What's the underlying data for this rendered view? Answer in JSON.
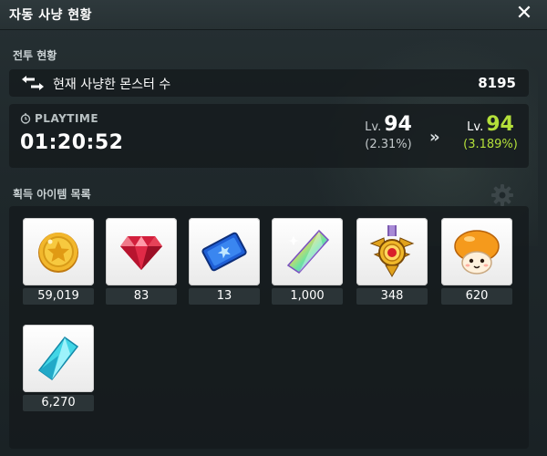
{
  "window": {
    "title": "자동 사냥 현황",
    "close_symbol": "✕"
  },
  "battle": {
    "section_label": "전투 현황",
    "monster_label": "현재 사냥한 몬스터 수",
    "monster_count": "8195",
    "playtime_label": "PLAYTIME",
    "playtime_value": "01:20:52",
    "level_from": {
      "prefix": "Lv.",
      "level": "94",
      "percent": "(2.31%)"
    },
    "level_arrow": "»",
    "level_to": {
      "prefix": "Lv.",
      "level": "94",
      "percent": "(3.189%)"
    }
  },
  "items": {
    "section_label": "획득 아이템 목록",
    "list": [
      {
        "icon": "gold-coin-icon",
        "count": "59,019"
      },
      {
        "icon": "red-gem-icon",
        "count": "83"
      },
      {
        "icon": "blue-ticket-icon",
        "count": "13"
      },
      {
        "icon": "rainbow-crystal-icon",
        "count": "1,000"
      },
      {
        "icon": "medal-icon",
        "count": "348"
      },
      {
        "icon": "orange-mushroom-icon",
        "count": "620"
      },
      {
        "icon": "cyan-crystal-icon",
        "count": "6,270"
      }
    ]
  },
  "colors": {
    "accent_green": "#b4e03a",
    "panel_bg": "#141a1c",
    "window_bg": "#1f282b"
  }
}
